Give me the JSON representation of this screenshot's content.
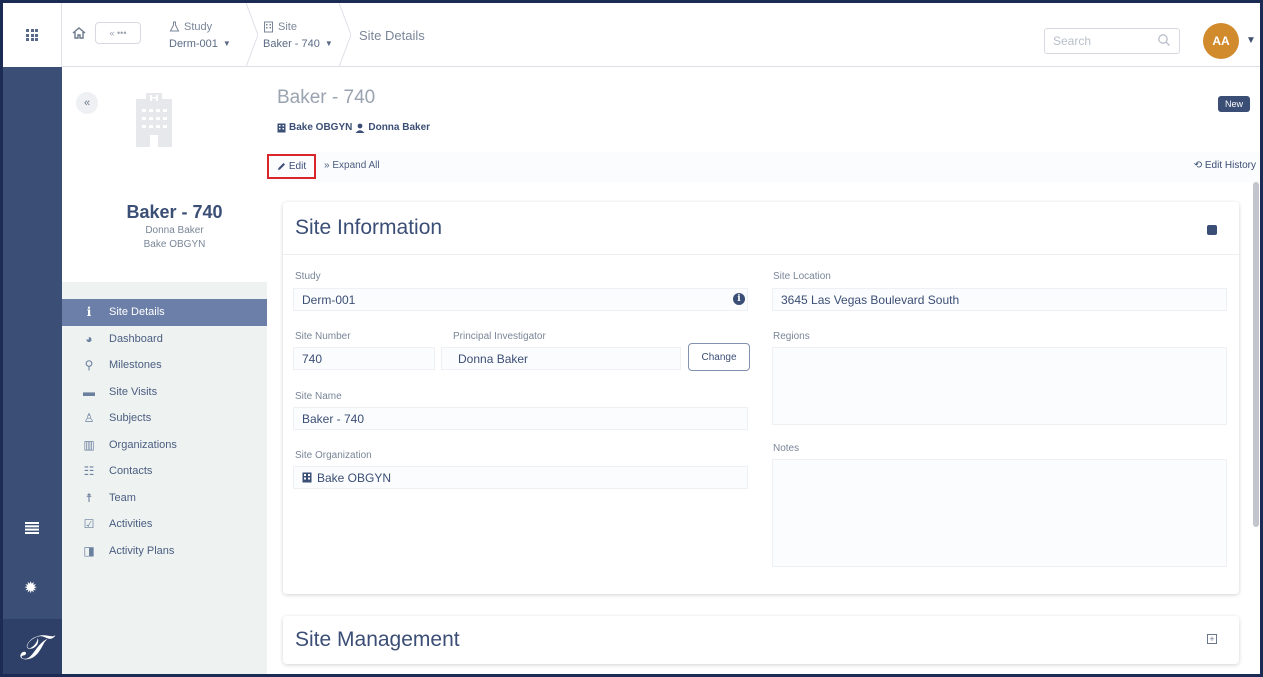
{
  "topbar": {
    "back_label": "« •••",
    "study_crumb": {
      "label": "Study",
      "value": "Derm-001"
    },
    "site_crumb": {
      "label": "Site",
      "value": "Baker - 740"
    },
    "current_crumb": "Site Details",
    "search_placeholder": "Search",
    "avatar_initials": "AA"
  },
  "rail": {
    "logo_glyph": "𝒯"
  },
  "sidepanel": {
    "collapse_label": "«",
    "site_name": "Baker - 740",
    "investigator": "Donna Baker",
    "organization": "Bake OBGYN",
    "nav": [
      {
        "label": "Site Details",
        "icon": "info-icon",
        "glyph": "i"
      },
      {
        "label": "Dashboard",
        "icon": "dashboard-icon",
        "glyph": "◕"
      },
      {
        "label": "Milestones",
        "icon": "map-marker-icon",
        "glyph": "⚲"
      },
      {
        "label": "Site Visits",
        "icon": "briefcase-icon",
        "glyph": "▬"
      },
      {
        "label": "Subjects",
        "icon": "person-icon",
        "glyph": "♙"
      },
      {
        "label": "Organizations",
        "icon": "building-icon",
        "glyph": "▥"
      },
      {
        "label": "Contacts",
        "icon": "users-icon",
        "glyph": "☷"
      },
      {
        "label": "Team",
        "icon": "team-member-icon",
        "glyph": "☨"
      },
      {
        "label": "Activities",
        "icon": "calendar-check-icon",
        "glyph": "☑"
      },
      {
        "label": "Activity Plans",
        "icon": "columns-icon",
        "glyph": "◨"
      }
    ]
  },
  "main": {
    "title": "Baker - 740",
    "subtitle_org": "Bake OBGYN",
    "subtitle_person": "Donna Baker",
    "badge": "New",
    "edit_label": "Edit",
    "expand_label": "Expand All",
    "history_label": "Edit History"
  },
  "site_info": {
    "title": "Site Information",
    "study_label": "Study",
    "study_value": "Derm-001",
    "site_number_label": "Site Number",
    "site_number_value": "740",
    "pi_label": "Principal Investigator",
    "pi_value": "Donna Baker",
    "change_label": "Change",
    "site_name_label": "Site Name",
    "site_name_value": "Baker - 740",
    "site_org_label": "Site Organization",
    "site_org_value": "Bake OBGYN",
    "location_label": "Site Location",
    "location_value": "3645 Las Vegas Boulevard South",
    "regions_label": "Regions",
    "notes_label": "Notes"
  },
  "site_mgmt": {
    "title": "Site Management"
  },
  "colors": {
    "navy": "#3b4e75",
    "accent_orange": "#d18a2c",
    "edit_highlight": "#d9262c"
  }
}
